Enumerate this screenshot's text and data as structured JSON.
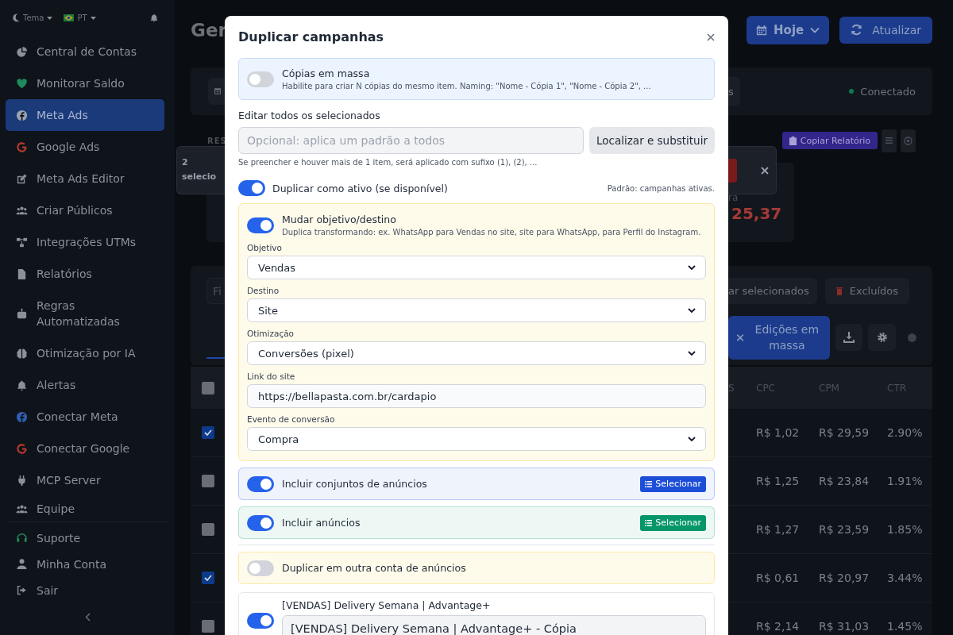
{
  "sidebar": {
    "theme": "Tema",
    "language": "PT",
    "items": [
      {
        "label": "Central de Contas",
        "selected": false
      },
      {
        "label": "Monitorar Saldo",
        "selected": false
      },
      {
        "label": "Meta Ads",
        "selected": true
      },
      {
        "label": "Google Ads",
        "selected": false
      },
      {
        "label": "Meta Ads Editor",
        "selected": false
      },
      {
        "label": "Criar Públicos",
        "selected": false
      },
      {
        "label": "Integrações UTMs",
        "selected": false
      },
      {
        "label": "Relatórios",
        "selected": false
      },
      {
        "label": "Regras Automatizadas",
        "selected": false
      },
      {
        "label": "Otimização por IA",
        "selected": false
      },
      {
        "label": "Alertas",
        "selected": false
      },
      {
        "label": "Conectar Meta",
        "selected": false
      },
      {
        "label": "Conectar Google",
        "selected": false
      },
      {
        "label": "MCP Server",
        "selected": false
      },
      {
        "label": "Equipe",
        "selected": false
      }
    ],
    "footer_items": [
      "Suporte",
      "Minha Conta",
      "Sair"
    ]
  },
  "header": {
    "title": "Ger",
    "date_button": "Hoje",
    "refresh_button": "Atualizar"
  },
  "status_bar": {
    "partial_button": "s",
    "connection": "Conectado"
  },
  "summary": {
    "section_label": "RES",
    "copy_button": "Copiar Relatório",
    "toast": "2 selecio",
    "card": {
      "caption": "ra",
      "value": "25,37"
    }
  },
  "actions": {
    "filter_placeholder": "Fi",
    "selected_button": "ar selecionados",
    "deleted_button": "Excluídos",
    "bulk_edit_button": "Edições em massa"
  },
  "table": {
    "select_all": false,
    "columns": [
      "S",
      "CPC",
      "CPM",
      "CTR"
    ],
    "rows": [
      {
        "selected": true,
        "cells": [
          "",
          "R$ 1,02",
          "R$ 29,59",
          "2.90%"
        ]
      },
      {
        "selected": false,
        "cells": [
          "",
          "R$ 1,25",
          "R$ 23,84",
          "1.91%"
        ]
      },
      {
        "selected": false,
        "cells": [
          "",
          "R$ 1,27",
          "R$ 23,59",
          "1.85%"
        ]
      },
      {
        "selected": true,
        "cells": [
          "",
          "R$ 0,61",
          "R$ 20,97",
          "3.44%"
        ]
      },
      {
        "selected": false,
        "cells": [
          "",
          "R$ 2,14",
          "R$ 31,03",
          "1.45%"
        ]
      }
    ]
  },
  "dialog": {
    "title": "Duplicar campanhas",
    "bulk_copies": {
      "on": false,
      "label": "Cópias em massa",
      "hint": "Habilite para criar N cópias do mesmo item. Naming: \"Nome - Cópia 1\", \"Nome - Cópia 2\", ..."
    },
    "edit_all": {
      "label": "Editar todos os selecionados",
      "placeholder": "Opcional: aplica um padrão a todos",
      "button": "Localizar e substituir",
      "hint": "Se preencher e houver mais de 1 item, será aplicado com sufixo (1), (2), ..."
    },
    "duplicate_active": {
      "on": true,
      "label": "Duplicar como ativo (se disponível)",
      "note": "Padrão: campanhas ativas."
    },
    "change_objective": {
      "on": true,
      "label": "Mudar objetivo/destino",
      "hint": "Duplica transformando: ex. WhatsApp para Vendas no site, site para WhatsApp, para Perfil do Instagram.",
      "fields": [
        {
          "kind": "select",
          "label": "Objetivo",
          "value": "Vendas"
        },
        {
          "kind": "select",
          "label": "Destino",
          "value": "Site"
        },
        {
          "kind": "select",
          "label": "Otimização",
          "value": "Conversões (pixel)"
        },
        {
          "kind": "input",
          "label": "Link do site",
          "value": "https://bellapasta.com.br/cardapio"
        },
        {
          "kind": "select",
          "label": "Evento de conversão",
          "value": "Compra"
        }
      ]
    },
    "includes": [
      {
        "on": true,
        "label": "Incluir conjuntos de anúncios",
        "button": "Selecionar",
        "color": "#1d4ed8"
      },
      {
        "on": true,
        "label": "Incluir anúncios",
        "button": "Selecionar",
        "color": "#059669"
      }
    ],
    "other_account": {
      "on": false,
      "label": "Duplicar em outra conta de anúncios"
    },
    "items": [
      {
        "on": true,
        "title": "[VENDAS] Delivery Semana | Advantage+",
        "name": "[VENDAS] Delivery Semana | Advantage+ - Cópia"
      }
    ]
  }
}
